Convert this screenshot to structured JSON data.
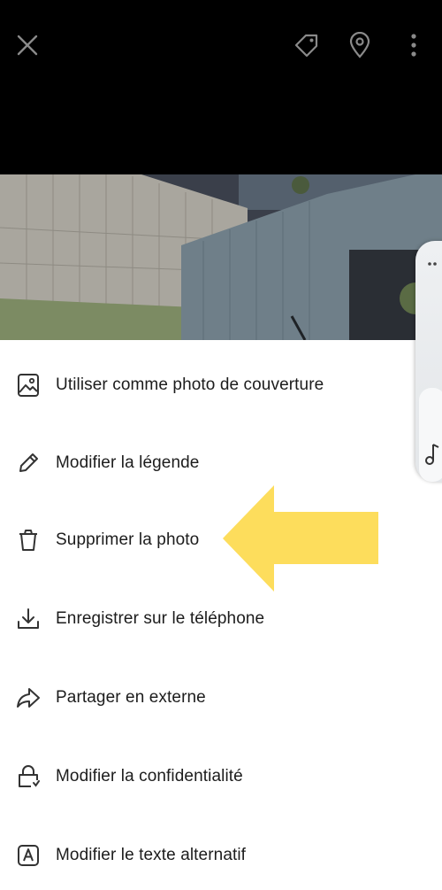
{
  "topbar": {
    "close_icon": "close-icon",
    "tag_icon": "tag-icon",
    "location_icon": "location-pin-icon",
    "more_icon": "more-vertical-icon"
  },
  "menu": {
    "items": [
      {
        "label": "Utiliser comme photo de couverture",
        "icon": "cover-photo-icon"
      },
      {
        "label": "Modifier la légende",
        "icon": "pencil-icon"
      },
      {
        "label": "Supprimer la photo",
        "icon": "trash-icon"
      },
      {
        "label": "Enregistrer sur le téléphone",
        "icon": "download-icon"
      },
      {
        "label": "Partager en externe",
        "icon": "share-arrow-icon"
      },
      {
        "label": "Modifier la confidentialité",
        "icon": "privacy-lock-icon"
      },
      {
        "label": "Modifier le texte alternatif",
        "icon": "alt-text-icon"
      }
    ]
  },
  "annotation": {
    "arrow_color": "#fddd5c"
  },
  "colors": {
    "header_bg": "#000000",
    "sheet_bg": "#ffffff",
    "text": "#1c1c1c"
  }
}
